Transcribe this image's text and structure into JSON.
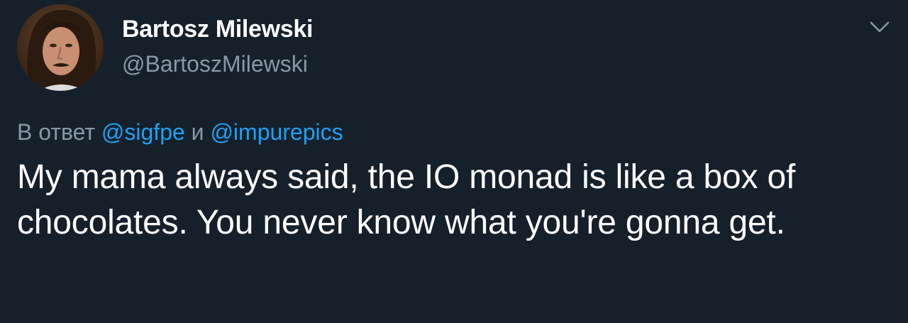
{
  "tweet": {
    "author": {
      "display_name": "Bartosz Milewski",
      "handle": "@BartoszMilewski",
      "avatar_icon": "user-avatar-photo"
    },
    "menu_icon": "chevron-down-icon",
    "reply": {
      "prefix": "В ответ",
      "mention_1": "@sigfpe",
      "conjunction": "и",
      "mention_2": "@impurepics"
    },
    "text": "My mama always said, the IO monad is like a box of chocolates. You never know what you're gonna get."
  },
  "colors": {
    "background": "#15202b",
    "primary_text": "#ffffff",
    "secondary_text": "#8899a6",
    "link": "#1da1f2"
  }
}
